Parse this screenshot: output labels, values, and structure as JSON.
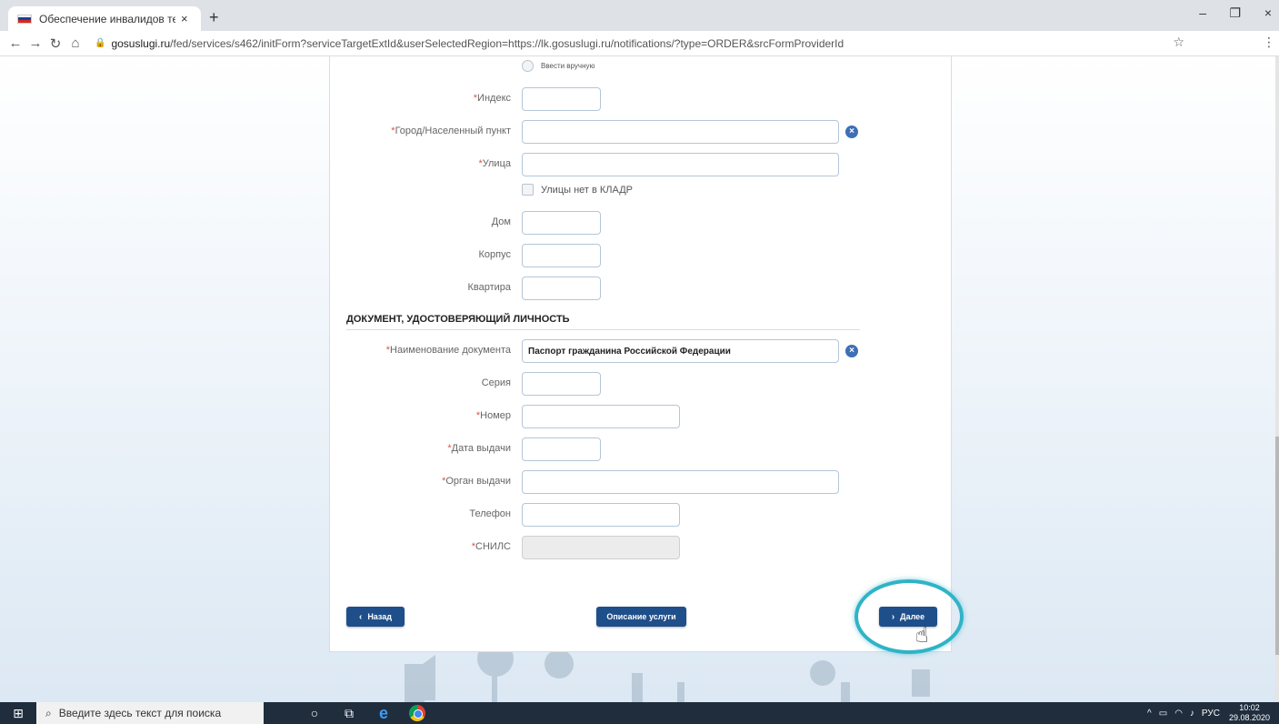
{
  "browser": {
    "tab_title": "Обеспечение инвалидов техни",
    "tab_close": "×",
    "new_tab": "+",
    "url_host": "gosuslugi.ru",
    "url_path": "/fed/services/s462/initForm?serviceTargetExtId&userSelectedRegion=https://lk.gosuslugi.ru/notifications/?type=ORDER&srcFormProviderId",
    "win_min": "–",
    "win_restore": "❐",
    "win_close": "×"
  },
  "address": {
    "manual_radio_label": "Ввести вручную",
    "index_label": "Индекс",
    "city_label": "Город/Населенный пункт",
    "street_label": "Улица",
    "no_street_label": "Улицы нет в КЛАДР",
    "house_label": "Дом",
    "building_label": "Корпус",
    "apartment_label": "Квартира"
  },
  "document": {
    "section_title": "ДОКУМЕНТ, УДОСТОВЕРЯЮЩИЙ ЛИЧНОСТЬ",
    "doc_name_label": "Наименование документа",
    "doc_name_value": "Паспорт гражданина Российской Федерации",
    "series_label": "Серия",
    "number_label": "Номер",
    "issue_date_label": "Дата выдачи",
    "issuer_label": "Орган выдачи",
    "phone_label": "Телефон",
    "snils_label": "СНИЛС"
  },
  "buttons": {
    "back": "Назад",
    "description": "Описание услуги",
    "next": "Далее"
  },
  "taskbar": {
    "search_placeholder": "Введите здесь текст для поиска",
    "lang": "РУС",
    "time": "10:02",
    "date": "29.08.2020"
  }
}
